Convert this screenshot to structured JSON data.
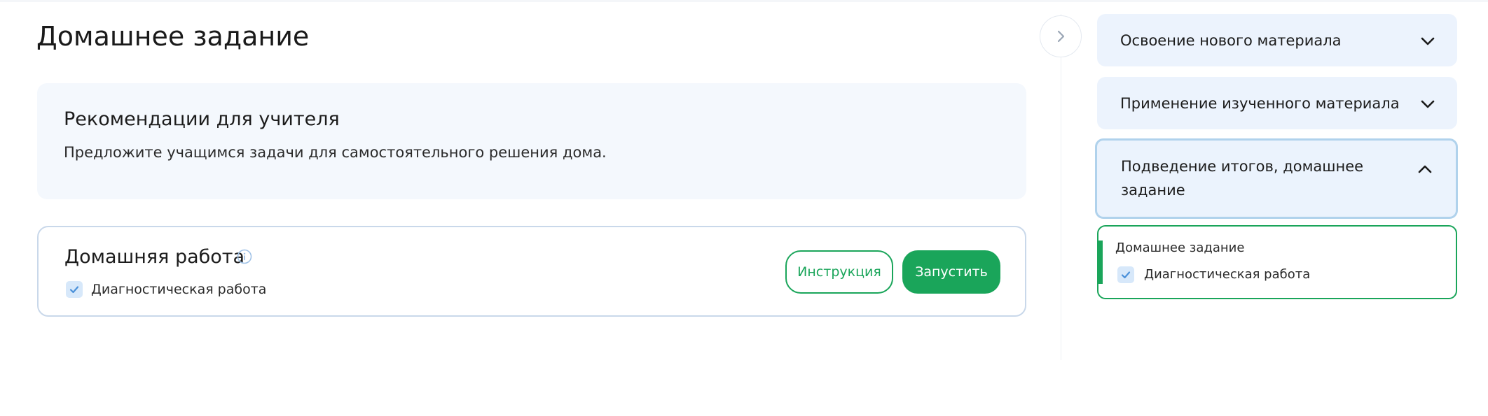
{
  "main": {
    "title": "Домашнее задание",
    "recommendation": {
      "title": "Рекомендации для учителя",
      "text": "Предложите учащимся задачи для самостоятельного решения дома."
    },
    "homework_card": {
      "title": "Домашняя работа",
      "info_icon": "info-icon",
      "checkbox_label": "Диагностическая работа",
      "checked": true,
      "instruction_button": "Инструкция",
      "start_button": "Запустить"
    }
  },
  "sidebar": {
    "toggle_icon": "chevron-right-icon",
    "sections": [
      {
        "label": "Освоение нового материала",
        "expanded": false,
        "icon": "chevron-down-icon"
      },
      {
        "label": "Применение изученного материала",
        "expanded": false,
        "icon": "chevron-down-icon"
      },
      {
        "label": "Подведение итогов, домашнее задание",
        "expanded": true,
        "icon": "chevron-up-icon"
      }
    ],
    "active_item": {
      "title": "Домашнее задание",
      "checkbox_label": "Диагностическая работа",
      "checked": true
    }
  },
  "colors": {
    "accent_green": "#1aa55a",
    "panel_bg": "#f4f8fd",
    "section_bg": "#ecf3fd",
    "card_border": "#c9d8ea"
  }
}
